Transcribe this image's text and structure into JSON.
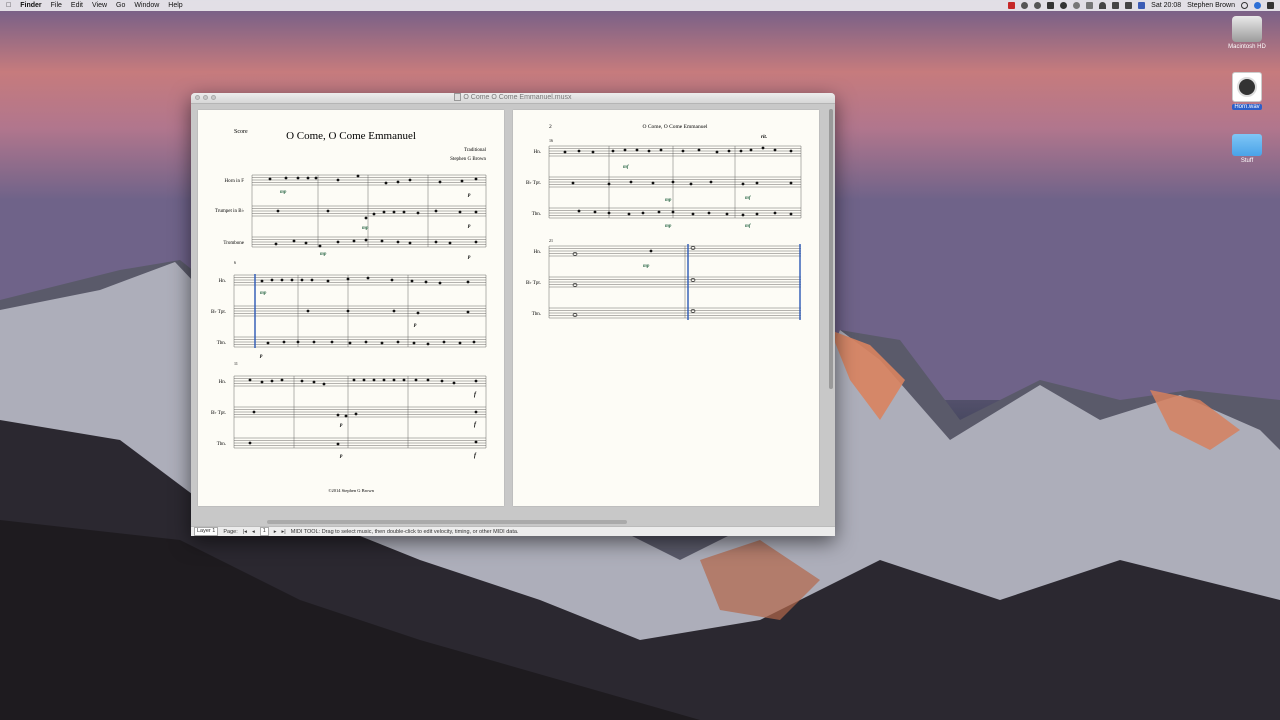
{
  "menubar": {
    "app": "Finder",
    "items": [
      "File",
      "Edit",
      "View",
      "Go",
      "Window",
      "Help"
    ],
    "clock": "Sat 20:08",
    "user": "Stephen Brown"
  },
  "desktop_icons": [
    {
      "label": "Macintosh HD"
    },
    {
      "label": "Horn.wav"
    },
    {
      "label": "Stuff"
    }
  ],
  "window": {
    "title": "O Come O Come Emmanuel.musx",
    "page1": {
      "corner_label": "Score",
      "title": "O Come, O Come Emmanuel",
      "credit1": "Traditional",
      "credit2": "Stephen G Brown",
      "copyright": "©2014 Stephen G Brown",
      "sys1_names": [
        "Horn in F",
        "Trumpet in B♭",
        "Trombone"
      ],
      "sys_short_names": [
        "Hn.",
        "B♭ Tpt.",
        "Tbn."
      ],
      "sys2_measure": "6",
      "sys3_measure": "11",
      "dyn_mp": "mp",
      "dyn_p": "p",
      "dyn_f": "f"
    },
    "page2": {
      "page_number": "2",
      "header": "O Come, O Come Emmanuel",
      "sys1_measure": "16",
      "sys2_measure": "21",
      "dyn_mf": "mf",
      "dyn_rit": "rit."
    },
    "status": {
      "layer": "Layer 1",
      "page_label": "Page:",
      "page_value": "1",
      "message": "MIDI TOOL: Drag to select music, then double-click to edit velocity, timing, or other MIDI data."
    }
  }
}
